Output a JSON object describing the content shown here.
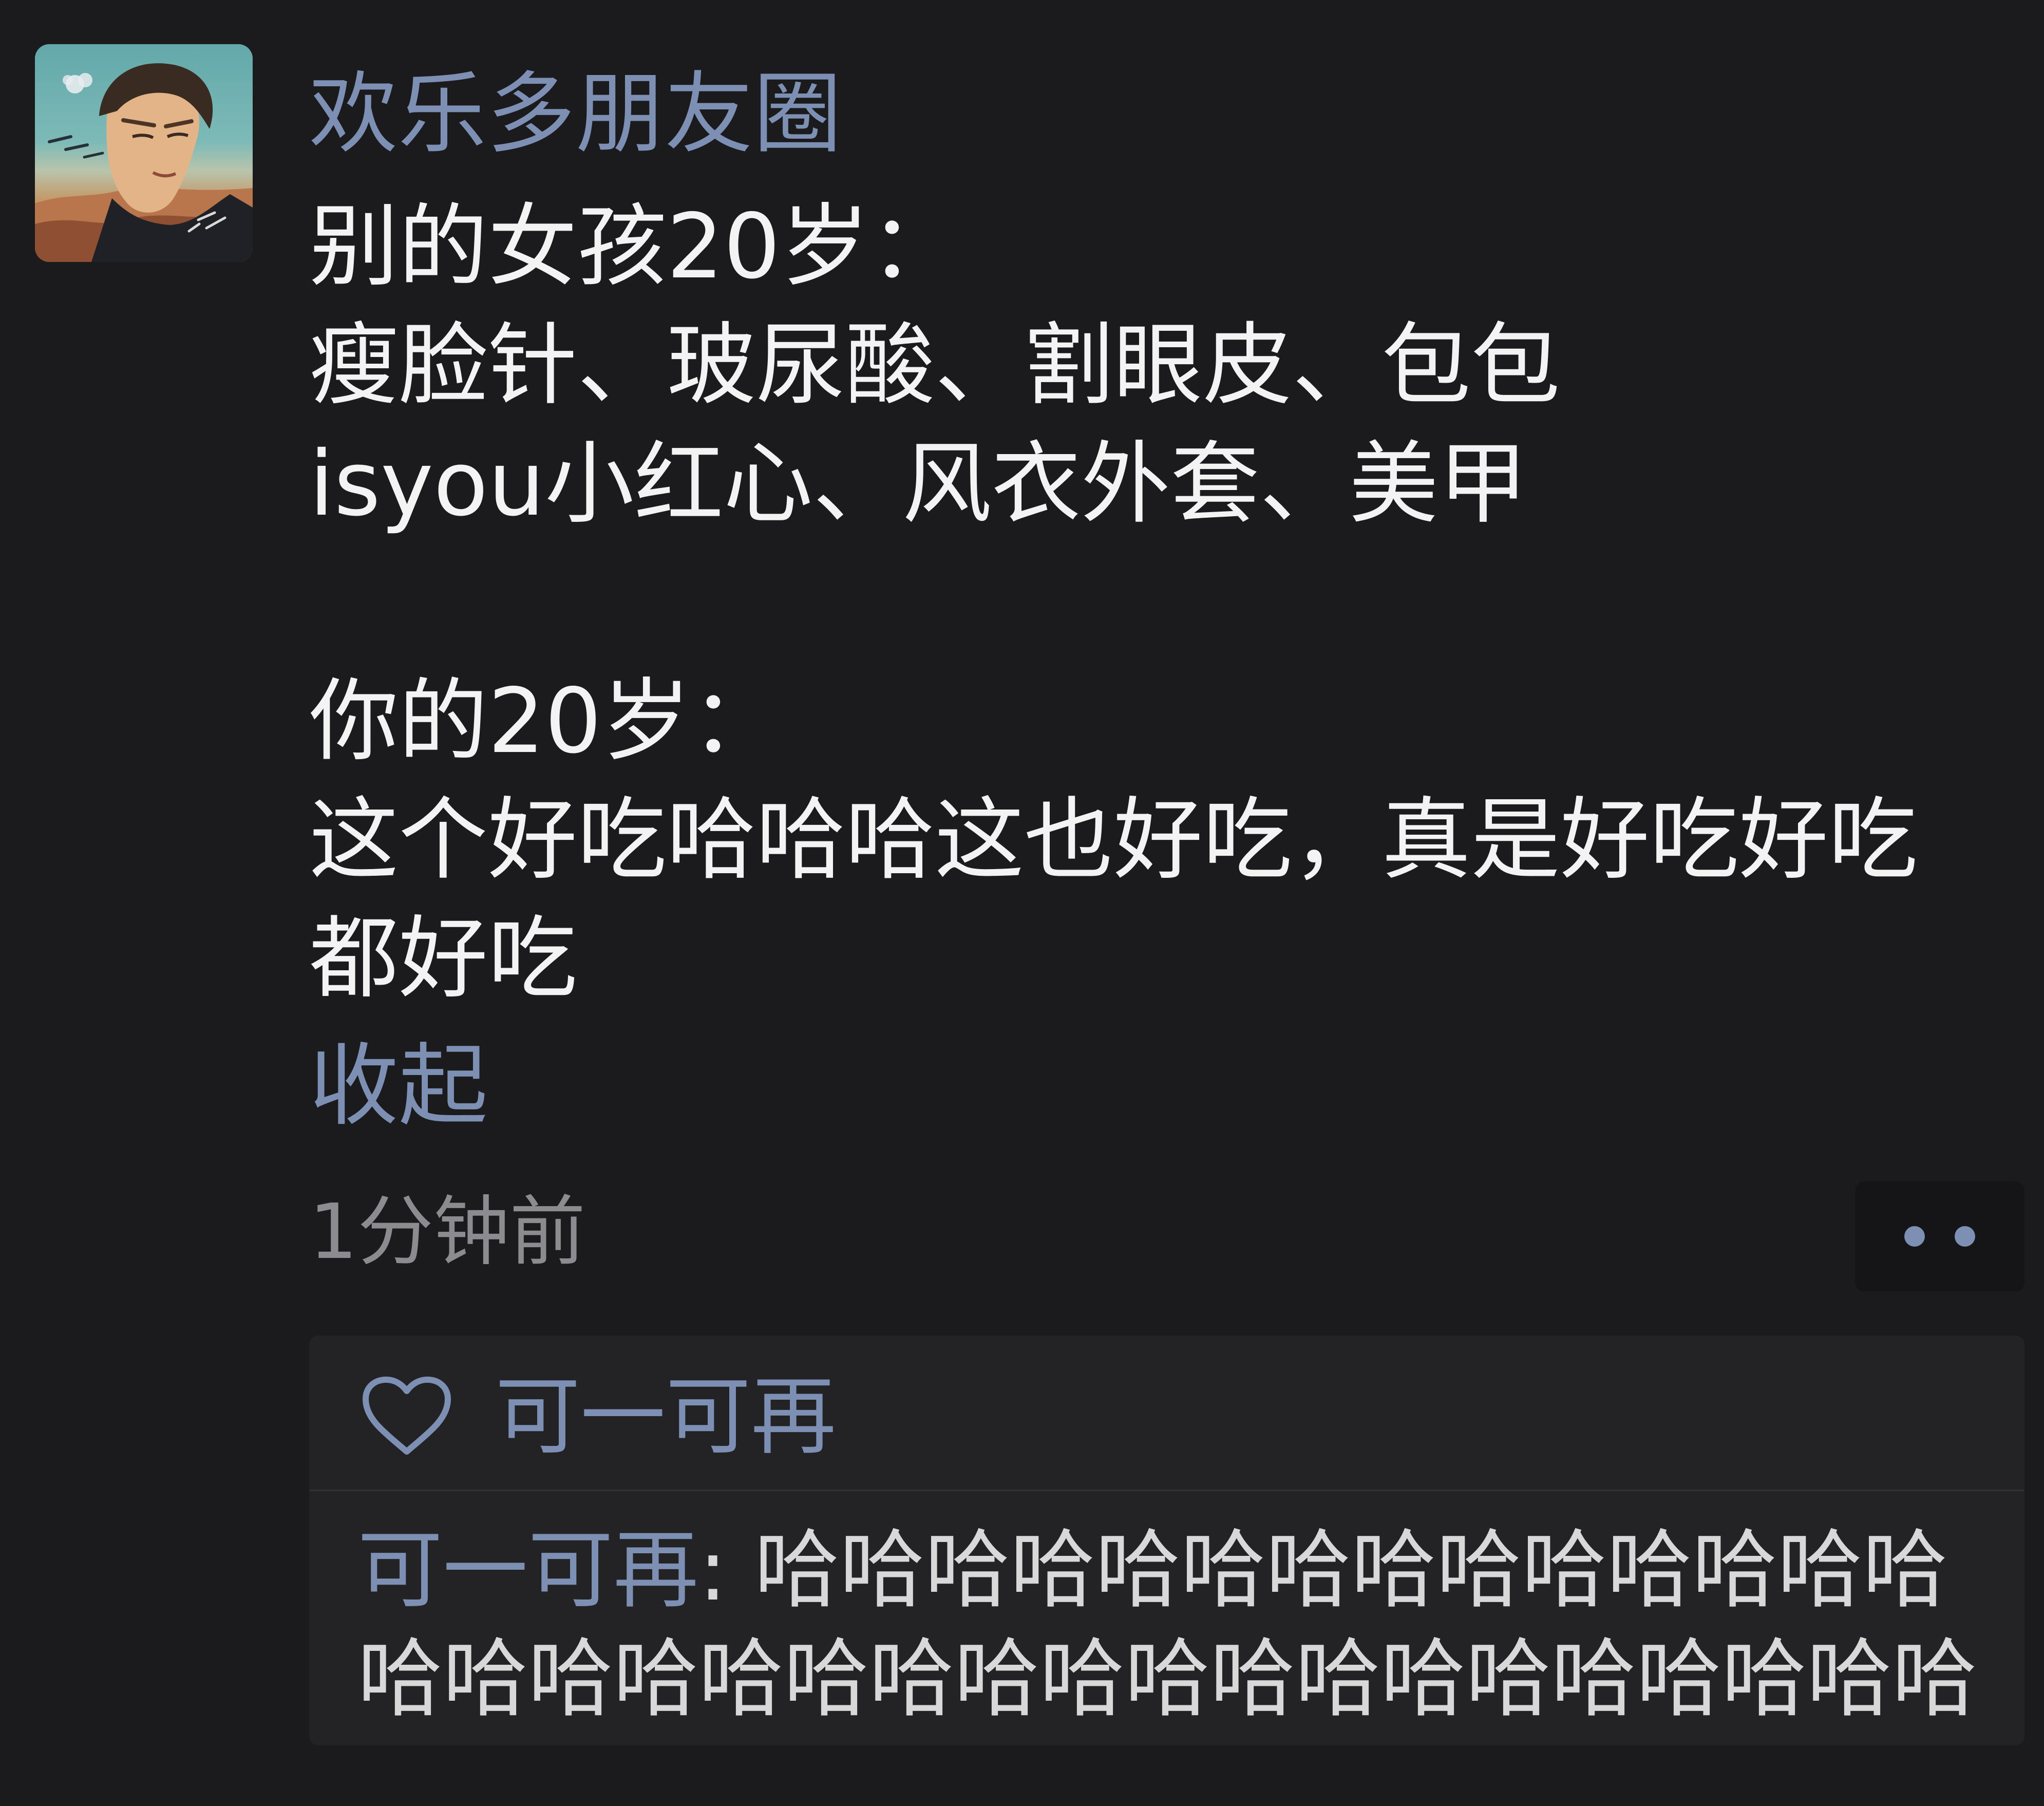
{
  "post": {
    "author": "欢乐多朋友圈",
    "content_lines": [
      "别的女孩20岁：",
      "瘦脸针、玻尿酸、割眼皮、包包",
      "isyou小红心、风衣外套、美甲",
      "",
      "你的20岁：",
      "这个好吃哈哈哈这也好吃，真是好吃好吃",
      "都好吃"
    ],
    "collapse_label": "收起",
    "timestamp": "1分钟前",
    "more_icon": "ellipsis-icon"
  },
  "interactions": {
    "like_icon": "heart-icon",
    "liked_by": "可一可再",
    "comments": [
      {
        "author": "可一可再",
        "separator": ": ",
        "text": "哈哈哈哈哈哈哈哈哈哈哈哈哈哈哈哈哈哈哈哈哈哈哈哈哈哈哈哈哈哈哈哈哈哈"
      }
    ]
  },
  "colors": {
    "background": "#1b1b1d",
    "accent": "#7e8fb4",
    "text_primary": "#f3f3f3",
    "text_secondary": "#8b8b90",
    "panel": "#232326"
  }
}
